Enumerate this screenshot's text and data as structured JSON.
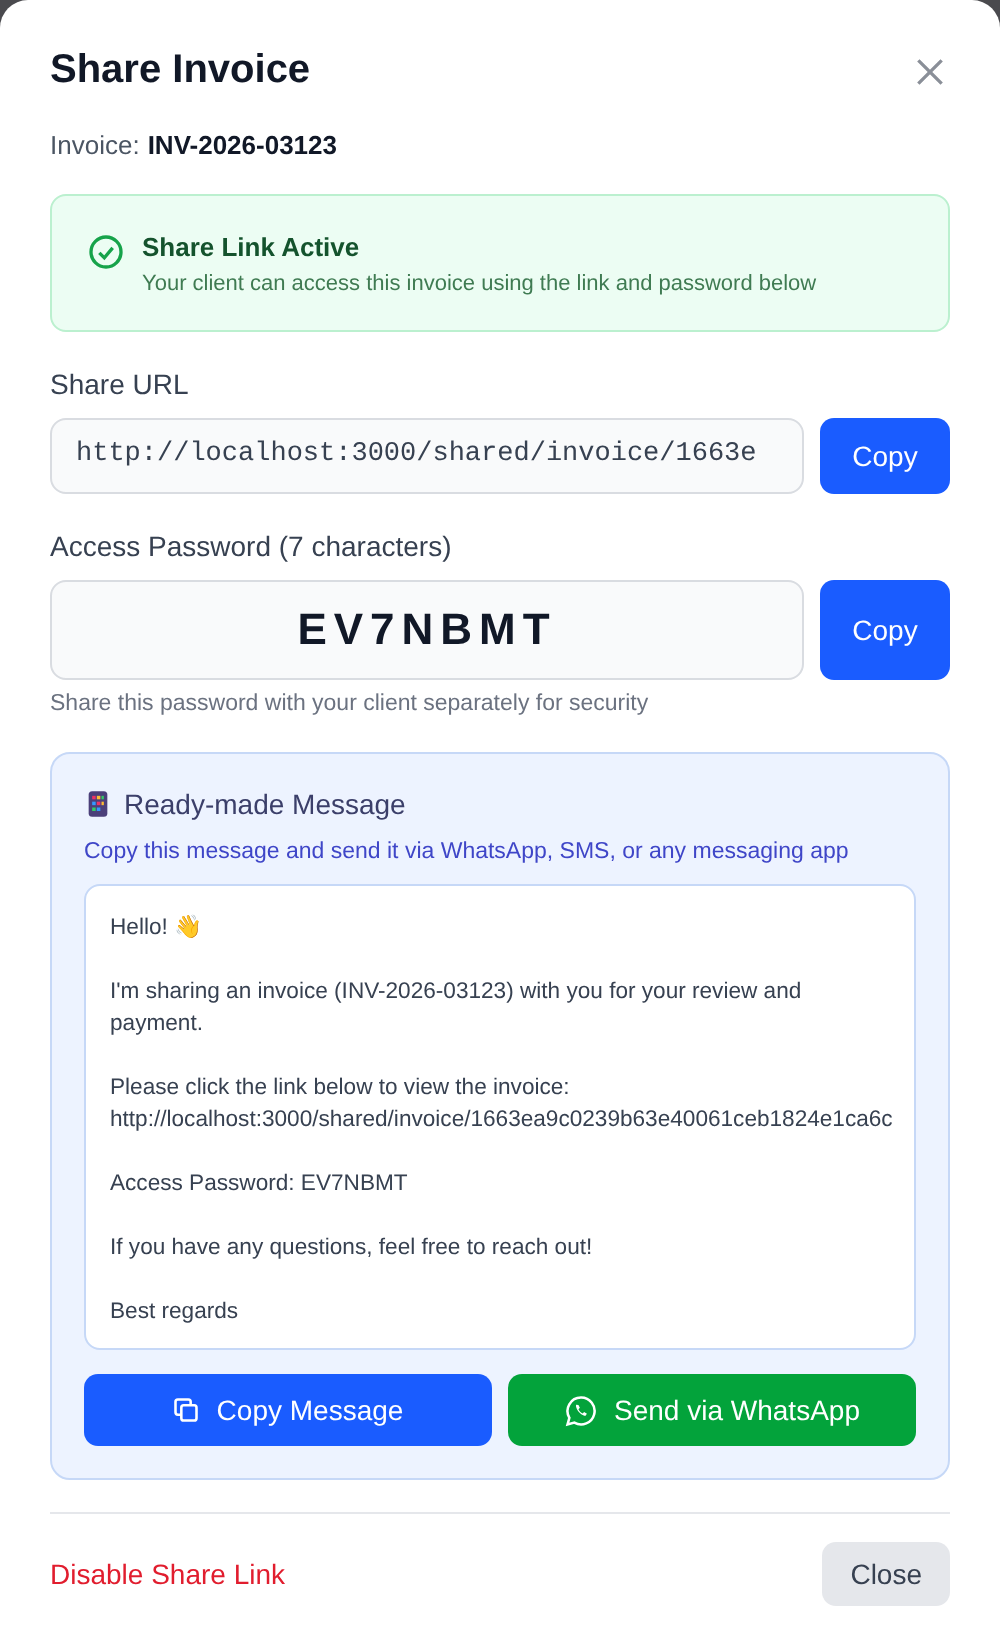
{
  "dialog": {
    "title": "Share Invoice",
    "invoice_label": "Invoice:",
    "invoice_number": "INV-2026-03123"
  },
  "status": {
    "active": true,
    "title": "Share Link Active",
    "text": "Your client can access this invoice using the link and password below"
  },
  "share_url": {
    "label": "Share URL",
    "value": "http://localhost:3000/shared/invoice/1663e",
    "button": "Copy"
  },
  "password": {
    "label": "Access Password (7 characters)",
    "value": "EV7NBMT",
    "button": "Copy",
    "hint": "Share this password with your client separately for security"
  },
  "message": {
    "title": "Ready-made Message",
    "subtitle": "Copy this message and send it via WhatsApp, SMS, or any messaging app",
    "paragraphs": [
      [
        "Hello! 👋"
      ],
      [
        "I'm sharing an invoice (INV-2026-03123) with you for your review and payment."
      ],
      [
        "Please click the link below to view the invoice:",
        "http://localhost:3000/shared/invoice/1663ea9c0239b63e40061ceb1824e1ca6c"
      ],
      [
        "Access Password: EV7NBMT"
      ],
      [
        "If you have any questions, feel free to reach out!"
      ],
      [
        "Best regards"
      ]
    ],
    "buttons": [
      {
        "kind": "copy",
        "label": "Copy Message"
      },
      {
        "kind": "whatsapp",
        "label": "Send via WhatsApp"
      }
    ]
  },
  "footer": {
    "disable_link": "Disable Share Link",
    "close": "Close"
  }
}
